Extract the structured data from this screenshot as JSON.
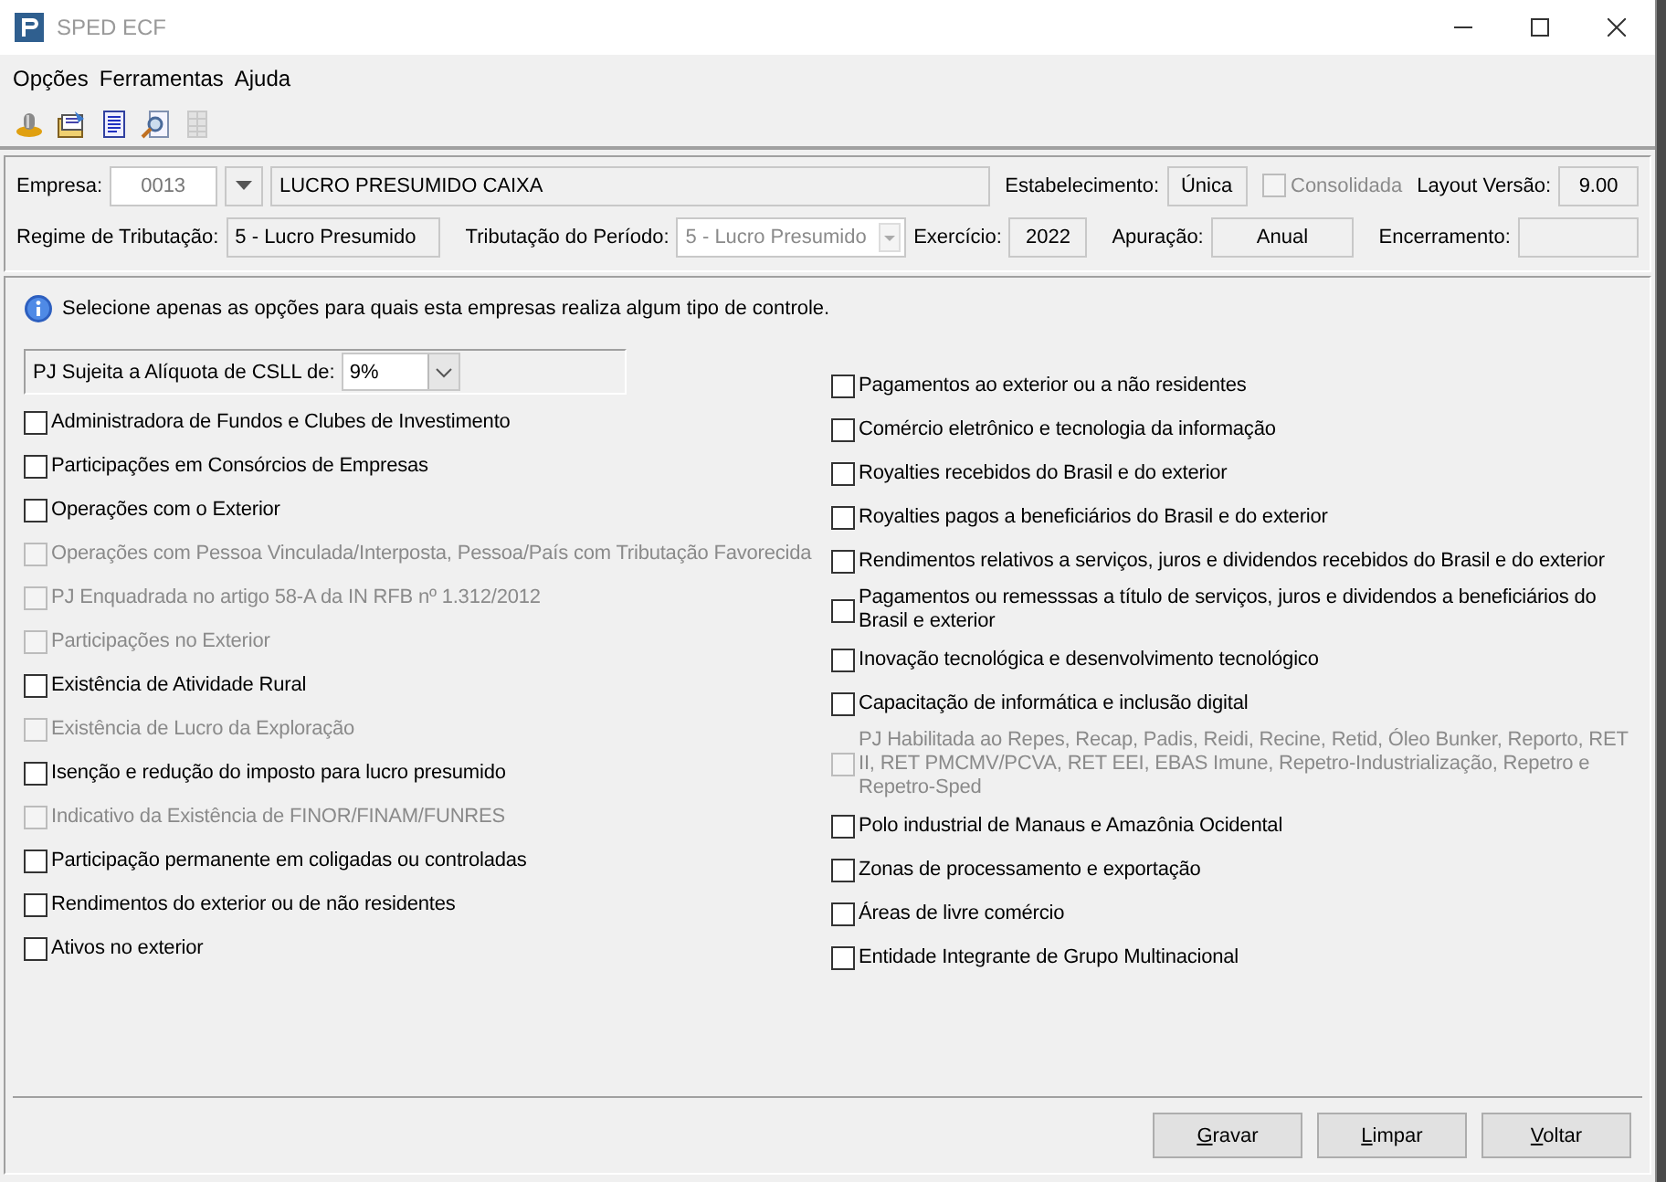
{
  "window": {
    "title": "SPED ECF"
  },
  "menu": [
    "Opções",
    "Ferramentas",
    "Ajuda"
  ],
  "toolbar": [
    {
      "kind": "pin",
      "disabled": false
    },
    {
      "kind": "folder",
      "disabled": false
    },
    {
      "kind": "document",
      "disabled": false
    },
    {
      "kind": "search",
      "disabled": false
    },
    {
      "kind": "grid",
      "disabled": true
    }
  ],
  "header": {
    "company": {
      "label": "Empresa:",
      "code": "0013",
      "name": "LUCRO PRESUMIDO CAIXA"
    },
    "establishment": {
      "label": "Estabelecimento:",
      "value": "Única"
    },
    "consolidated": {
      "label": "Consolidada",
      "checked": false,
      "disabled": true
    },
    "layout_version": {
      "label": "Layout Versão:",
      "value": "9.00"
    },
    "regime": {
      "label": "Regime de Tributação:",
      "value": "5 - Lucro Presumido"
    },
    "period_taxation": {
      "label": "Tributação do Período:",
      "value": "5 - Lucro Presumido",
      "disabled": true
    },
    "fiscal_year": {
      "label": "Exercício:",
      "value": "2022"
    },
    "assessment": {
      "label": "Apuração:",
      "value": "Anual"
    },
    "closing": {
      "label": "Encerramento:"
    }
  },
  "info": "Selecione apenas as opções para quais esta  empresas realiza algum tipo de controle.",
  "csll": {
    "label": "PJ Sujeita a Alíquota de CSLL de:",
    "value": "9%"
  },
  "options_left": [
    {
      "label": "Administradora de Fundos e Clubes de Investimento",
      "checked": false,
      "disabled": false
    },
    {
      "label": "Participações em Consórcios de Empresas",
      "checked": false,
      "disabled": false
    },
    {
      "label": "Operações com o Exterior",
      "checked": false,
      "disabled": false
    },
    {
      "label": "Operações com Pessoa Vinculada/Interposta, Pessoa/País com Tributação Favorecida",
      "checked": false,
      "disabled": true
    },
    {
      "label": "PJ Enquadrada no artigo 58-A da IN RFB nº 1.312/2012",
      "checked": false,
      "disabled": true
    },
    {
      "label": "Participações no Exterior",
      "checked": false,
      "disabled": true
    },
    {
      "label": "Existência de Atividade Rural",
      "checked": false,
      "disabled": false
    },
    {
      "label": "Existência de Lucro da Exploração",
      "checked": false,
      "disabled": true
    },
    {
      "label": "Isenção e redução do imposto para lucro presumido",
      "checked": false,
      "disabled": false
    },
    {
      "label": "Indicativo da Existência de FINOR/FINAM/FUNRES",
      "checked": false,
      "disabled": true
    },
    {
      "label": "Participação permanente em coligadas ou controladas",
      "checked": false,
      "disabled": false
    },
    {
      "label": "Rendimentos do exterior ou de não residentes",
      "checked": false,
      "disabled": false
    },
    {
      "label": "Ativos no exterior",
      "checked": false,
      "disabled": false
    }
  ],
  "options_right": [
    {
      "label": "Pagamentos ao exterior ou a não residentes",
      "checked": false,
      "disabled": false
    },
    {
      "label": "Comércio eletrônico e tecnologia da informação",
      "checked": false,
      "disabled": false
    },
    {
      "label": "Royalties recebidos do Brasil e do exterior",
      "checked": false,
      "disabled": false
    },
    {
      "label": "Royalties pagos a beneficiários do Brasil e do exterior",
      "checked": false,
      "disabled": false
    },
    {
      "label": "Rendimentos relativos a serviços, juros e dividendos recebidos do Brasil e do exterior",
      "checked": false,
      "disabled": false
    },
    {
      "label": "Pagamentos ou remesssas a título de serviços, juros e dividendos a beneficiários do Brasil e exterior",
      "checked": false,
      "disabled": false
    },
    {
      "label": "Inovação tecnológica e desenvolvimento tecnológico",
      "checked": false,
      "disabled": false
    },
    {
      "label": "Capacitação de informática e inclusão digital",
      "checked": false,
      "disabled": false
    },
    {
      "label": "PJ Habilitada ao Repes, Recap, Padis, Reidi, Recine, Retid, Óleo Bunker, Reporto, RET II, RET PMCMV/PCVA, RET EEI, EBAS Imune, Repetro-Industrialização, Repetro e Repetro-Sped",
      "checked": false,
      "disabled": true
    },
    {
      "label": "Polo industrial de Manaus e Amazônia Ocidental",
      "checked": false,
      "disabled": false
    },
    {
      "label": "Zonas de processamento e exportação",
      "checked": false,
      "disabled": false
    },
    {
      "label": "Áreas de livre comércio",
      "checked": false,
      "disabled": false
    },
    {
      "label": "Entidade Integrante de Grupo Multinacional",
      "checked": false,
      "disabled": false
    }
  ],
  "buttons": [
    {
      "label": "Gravar",
      "underlined": true
    },
    {
      "label": "Limpar",
      "underlined": true
    },
    {
      "label": "Voltar",
      "underlined": true
    }
  ]
}
